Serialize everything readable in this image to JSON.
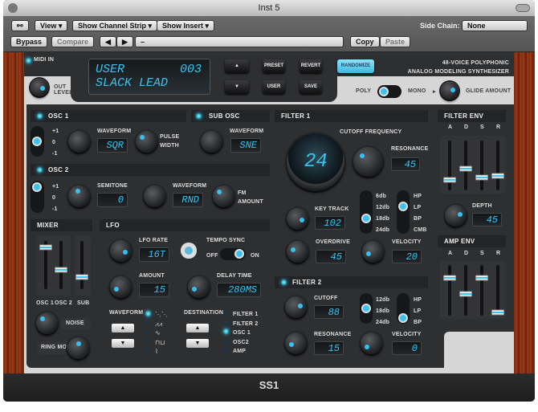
{
  "window": {
    "title": "Inst 5",
    "footer": "SS1"
  },
  "toolbar": {
    "view": "View ▾",
    "channel_strip": "Show Channel Strip ▾",
    "insert": "Show Insert ▾",
    "side_chain_label": "Side Chain:",
    "side_chain_value": "None",
    "bypass": "Bypass",
    "compare": "Compare",
    "prev": "◀",
    "next": "▶",
    "preset": "–",
    "copy": "Copy",
    "paste": "Paste"
  },
  "header": {
    "midi_in": "MIDI IN",
    "out_level": [
      "OUT",
      "LEVEL"
    ],
    "lcd_line1_left": "USER",
    "lcd_line1_right": "003",
    "lcd_line2": "SLACK LEAD",
    "preset": "PRESET",
    "revert": "REVERT",
    "randomize": "RANDOMIZE",
    "user": "USER",
    "save": "SAVE",
    "tagline1": "48-VOICE POLYPHONIC",
    "tagline2": "ANALOG MODELING SYNTHESIZER",
    "poly": "POLY",
    "mono": "MONO",
    "glide": "GLIDE AMOUNT",
    "up": "▲",
    "down": "▼"
  },
  "osc1": {
    "title": "OSC 1",
    "oct": [
      "+1",
      "0",
      "-1"
    ],
    "waveform_label": "WAVEFORM",
    "waveform": "SQR",
    "pulse": [
      "PULSE",
      "WIDTH"
    ]
  },
  "sub_osc": {
    "title": "SUB OSC",
    "waveform_label": "WAVEFORM",
    "waveform": "SNE"
  },
  "osc2": {
    "title": "OSC 2",
    "oct": [
      "+1",
      "0",
      "-1"
    ],
    "semitone_label": "SEMITONE",
    "semitone": "0",
    "waveform_label": "WAVEFORM",
    "waveform": "RND",
    "fm": [
      "FM",
      "AMOUNT"
    ]
  },
  "mixer": {
    "title": "MIXER",
    "osc1": "OSC 1",
    "osc2": "OSC 2",
    "sub": "SUB",
    "noise": "NOISE",
    "ring": "RING MOD",
    "levels": {
      "osc1": 0.85,
      "osc2": 0.45,
      "sub": 0.3
    }
  },
  "lfo": {
    "title": "LFO",
    "rate_label": "LFO RATE",
    "rate": "16T",
    "tempo_sync": "TEMPO SYNC",
    "off": "OFF",
    "on": "ON",
    "amount_label": "AMOUNT",
    "amount": "15",
    "delay_label": "DELAY TIME",
    "delay": "280MS",
    "waveform_label": "WAVEFORM",
    "waves": [
      "⋱⋱",
      "⩘⩘",
      "∿",
      "⊓⊔",
      "⌇"
    ],
    "destination_label": "DESTINATION",
    "destinations": [
      "FILTER 1",
      "FILTER 2",
      "OSC 1",
      "OSC2",
      "AMP"
    ],
    "selected_destination": "OSC 1"
  },
  "filter1": {
    "title": "FILTER 1",
    "cutoff_label": "CUTOFF FREQUENCY",
    "cutoff": "24",
    "res_label": "RESONANCE",
    "res": "45",
    "slopes": [
      "6db",
      "12db",
      "18db",
      "24db"
    ],
    "types": [
      "HP",
      "LP",
      "BP",
      "CMB"
    ],
    "key_label": "KEY TRACK",
    "key": "102",
    "od_label": "OVERDRIVE",
    "od": "45",
    "vel_label": "VELOCITY",
    "vel": "20"
  },
  "filter2": {
    "title": "FILTER 2",
    "cutoff_label": "CUTOFF",
    "cutoff": "88",
    "res_label": "RESONANCE",
    "res": "15",
    "slopes": [
      "12db",
      "18db",
      "24db"
    ],
    "types": [
      "HP",
      "LP",
      "BP"
    ],
    "vel_label": "VELOCITY",
    "vel": "0"
  },
  "filter_env": {
    "title": "FILTER ENV",
    "adsr": [
      "A",
      "D",
      "S",
      "R"
    ],
    "depth_label": "DEPTH",
    "depth": "45"
  },
  "amp_env": {
    "title": "AMP ENV",
    "adsr": [
      "A",
      "D",
      "S",
      "R"
    ]
  },
  "colors": {
    "accent": "#38c4f0",
    "panel": "#2e2f31"
  }
}
